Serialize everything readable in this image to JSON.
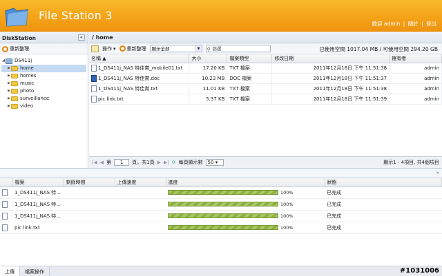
{
  "app": {
    "title": "File Station 3"
  },
  "top_links": {
    "welcome": "歡迎 admin",
    "about": "關於",
    "logout": "登出",
    "sep": "|"
  },
  "sidebar": {
    "title": "DiskStation",
    "collapse": "«",
    "refresh_label": "重新整理",
    "root": "DS411j",
    "items": [
      {
        "label": "home"
      },
      {
        "label": "homes"
      },
      {
        "label": "music"
      },
      {
        "label": "photo"
      },
      {
        "label": "surveillance"
      },
      {
        "label": "video"
      }
    ]
  },
  "path": "/ home",
  "toolbar": {
    "action_label": "操作",
    "refresh_label": "重新整理",
    "view_value": "顯示全部",
    "search_placeholder": "篩選",
    "quota": "已使用空間 1017.04 MB / 可使用空間 294.20 GB"
  },
  "file_table": {
    "columns": {
      "name": "名稱 ▲",
      "size": "大小",
      "type": "檔案類型",
      "modified": "修改日期",
      "owner": "擁有者"
    },
    "rows": [
      {
        "name": "1_DS411j_NAS 特佳賞_mobile01.txt",
        "size": "17.20 KB",
        "type": "TXT 檔案",
        "modified": "2011年12月18日 下午 11:51:38",
        "owner": "admin",
        "icon": "txt"
      },
      {
        "name": "1_DS411j_NAS 特佳賞.doc",
        "size": "10.23 MB",
        "type": "DOC 檔案",
        "modified": "2011年12月18日 下午 11:51:37",
        "owner": "admin",
        "icon": "doc"
      },
      {
        "name": "1_DS411j_NAS 特佳賞.txt",
        "size": "11.01 KB",
        "type": "TXT 檔案",
        "modified": "2011年12月18日 下午 11:51:38",
        "owner": "admin",
        "icon": "txt"
      },
      {
        "name": "pic link.txt",
        "size": "5.37 KB",
        "type": "TXT 檔案",
        "modified": "2011年12月18日 下午 11:51:39",
        "owner": "admin",
        "icon": "txt"
      }
    ]
  },
  "pager": {
    "page_prefix": "第",
    "page_value": "1",
    "page_suffix": "頁，共1頁",
    "per_page_label": "每頁顯示數",
    "per_page_value": "50",
    "info": "顯示1 - 4項目, 共4個項目"
  },
  "upload_table": {
    "columns": {
      "file": "檔案",
      "remaining": "剩餘時間",
      "speed": "上傳速度",
      "progress": "進度",
      "status": "狀態"
    },
    "rows": [
      {
        "file": "1_DS411j_NAS 特...",
        "progress": 1.0,
        "pct": "100%",
        "status": "已完成"
      },
      {
        "file": "1_DS411j_NAS 特...",
        "progress": 1.0,
        "pct": "100%",
        "status": "已完成"
      },
      {
        "file": "1_DS411j_NAS 特...",
        "progress": 1.0,
        "pct": "100%",
        "status": "已完成"
      },
      {
        "file": "pic link.txt",
        "progress": 1.0,
        "pct": "100%",
        "status": "已完成"
      }
    ]
  },
  "bottom_tabs": [
    {
      "label": "上傳"
    },
    {
      "label": "檔案操作"
    }
  ],
  "watermark": "#1031006",
  "colors": {
    "header": "#f4a318",
    "selection": "#c6daf3",
    "progress": "#8db044"
  }
}
